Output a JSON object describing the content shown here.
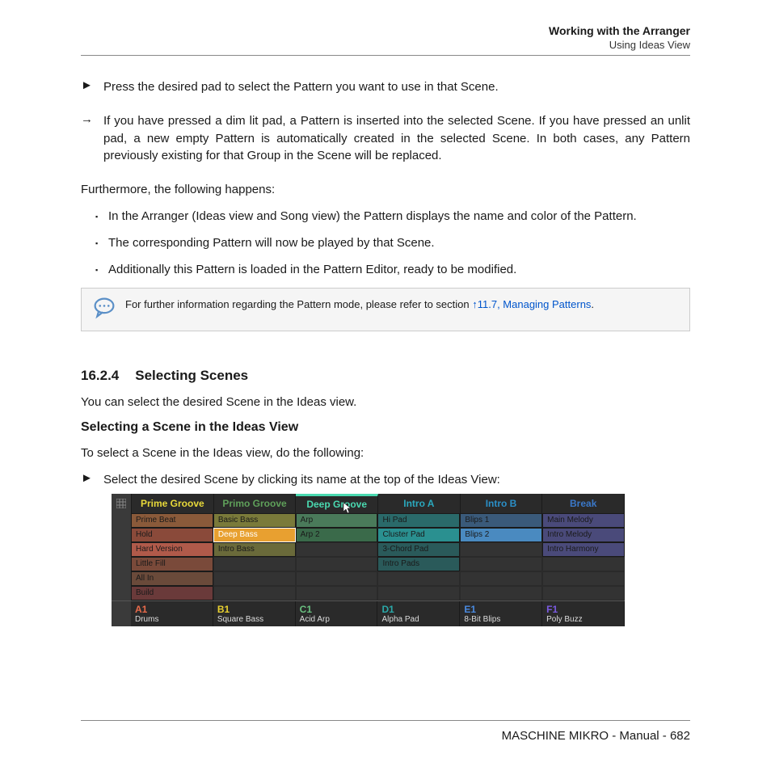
{
  "header": {
    "title": "Working with the Arranger",
    "sub": "Using Ideas View"
  },
  "step1": "Press the desired pad to select the Pattern you want to use in that Scene.",
  "step2": "If you have pressed a dim lit pad, a Pattern is inserted into the selected Scene. If you have pressed an unlit pad, a new empty Pattern is automatically created in the selected Scene. In both cases, any Pattern previously existing for that Group in the Scene will be replaced.",
  "furthermore": "Furthermore, the following happens:",
  "bullets": [
    "In the Arranger (Ideas view and Song view) the Pattern displays the name and color of the Pattern.",
    "The corresponding Pattern will now be played by that Scene.",
    "Additionally this Pattern is loaded in the Pattern Editor, ready to be modified."
  ],
  "info": {
    "pre": "For further information regarding the Pattern mode, please refer to section ",
    "link": "↑11.7, Managing Patterns",
    "post": "."
  },
  "section": {
    "num": "16.2.4",
    "title": "Selecting Scenes"
  },
  "para_select": "You can select the desired Scene in the Ideas view.",
  "subheading": "Selecting a Scene in the Ideas View",
  "para_todo": "To select a Scene in the Ideas view, do the following:",
  "step_select": "Select the desired Scene by clicking its name at the top of the Ideas View:",
  "scenes": [
    "Prime Groove",
    "Primo Groove",
    "Deep Groove",
    "Intro A",
    "Intro B",
    "Break"
  ],
  "scene_colors": [
    "#e8d93a",
    "#5fa05a",
    "#4ad9b0",
    "#2aa8bd",
    "#2a8fc7",
    "#3a78c9"
  ],
  "patterns": [
    [
      {
        "t": "Prime Beat",
        "c": "#8a5a3a"
      },
      {
        "t": "Basic Bass",
        "c": "#7a7a3a"
      },
      {
        "t": "Arp",
        "c": "#4a7a5a"
      },
      {
        "t": "Hi Pad",
        "c": "#2a6a6a"
      },
      {
        "t": "Blips 1",
        "c": "#3a5a7a"
      },
      {
        "t": "Main Melody",
        "c": "#4a4a7a"
      }
    ],
    [
      {
        "t": "Hold",
        "c": "#8a4a3a"
      },
      {
        "t": "Deep Bass",
        "c": "#e8a030",
        "sel": true
      },
      {
        "t": "Arp 2",
        "c": "#3a6a4a"
      },
      {
        "t": "Cluster Pad",
        "c": "#2a9090"
      },
      {
        "t": "Blips 2",
        "c": "#4a8ac0"
      },
      {
        "t": "Intro Melody",
        "c": "#4a4a7a"
      }
    ],
    [
      {
        "t": "Hard Version",
        "c": "#b05a4a"
      },
      {
        "t": "Intro Bass",
        "c": "#6a6a3a"
      },
      {
        "t": "",
        "c": ""
      },
      {
        "t": "3-Chord Pad",
        "c": "#2a5a5a"
      },
      {
        "t": "",
        "c": ""
      },
      {
        "t": "Intro Harmony",
        "c": "#4a4a7a"
      }
    ],
    [
      {
        "t": "Little Fill",
        "c": "#7a4a3a"
      },
      {
        "t": "",
        "c": ""
      },
      {
        "t": "",
        "c": ""
      },
      {
        "t": "Intro Pads",
        "c": "#2a5a5a"
      },
      {
        "t": "",
        "c": ""
      },
      {
        "t": "",
        "c": ""
      }
    ],
    [
      {
        "t": "All In",
        "c": "#6a4a3a"
      },
      {
        "t": "",
        "c": ""
      },
      {
        "t": "",
        "c": ""
      },
      {
        "t": "",
        "c": ""
      },
      {
        "t": "",
        "c": ""
      },
      {
        "t": "",
        "c": ""
      }
    ],
    [
      {
        "t": "Build",
        "c": "#6a3a3a"
      },
      {
        "t": "",
        "c": ""
      },
      {
        "t": "",
        "c": ""
      },
      {
        "t": "",
        "c": ""
      },
      {
        "t": "",
        "c": ""
      },
      {
        "t": "",
        "c": ""
      }
    ]
  ],
  "groups": [
    {
      "id": "A1",
      "name": "Drums",
      "c": "#e86a4a"
    },
    {
      "id": "B1",
      "name": "Square Bass",
      "c": "#e8d030"
    },
    {
      "id": "C1",
      "name": "Acid Arp",
      "c": "#6ac080"
    },
    {
      "id": "D1",
      "name": "Alpha Pad",
      "c": "#2aa8a8"
    },
    {
      "id": "E1",
      "name": "8-Bit Blips",
      "c": "#4a8ae0"
    },
    {
      "id": "F1",
      "name": "Poly Buzz",
      "c": "#7a5ae0"
    }
  ],
  "footer": "MASCHINE MIKRO - Manual - 682"
}
